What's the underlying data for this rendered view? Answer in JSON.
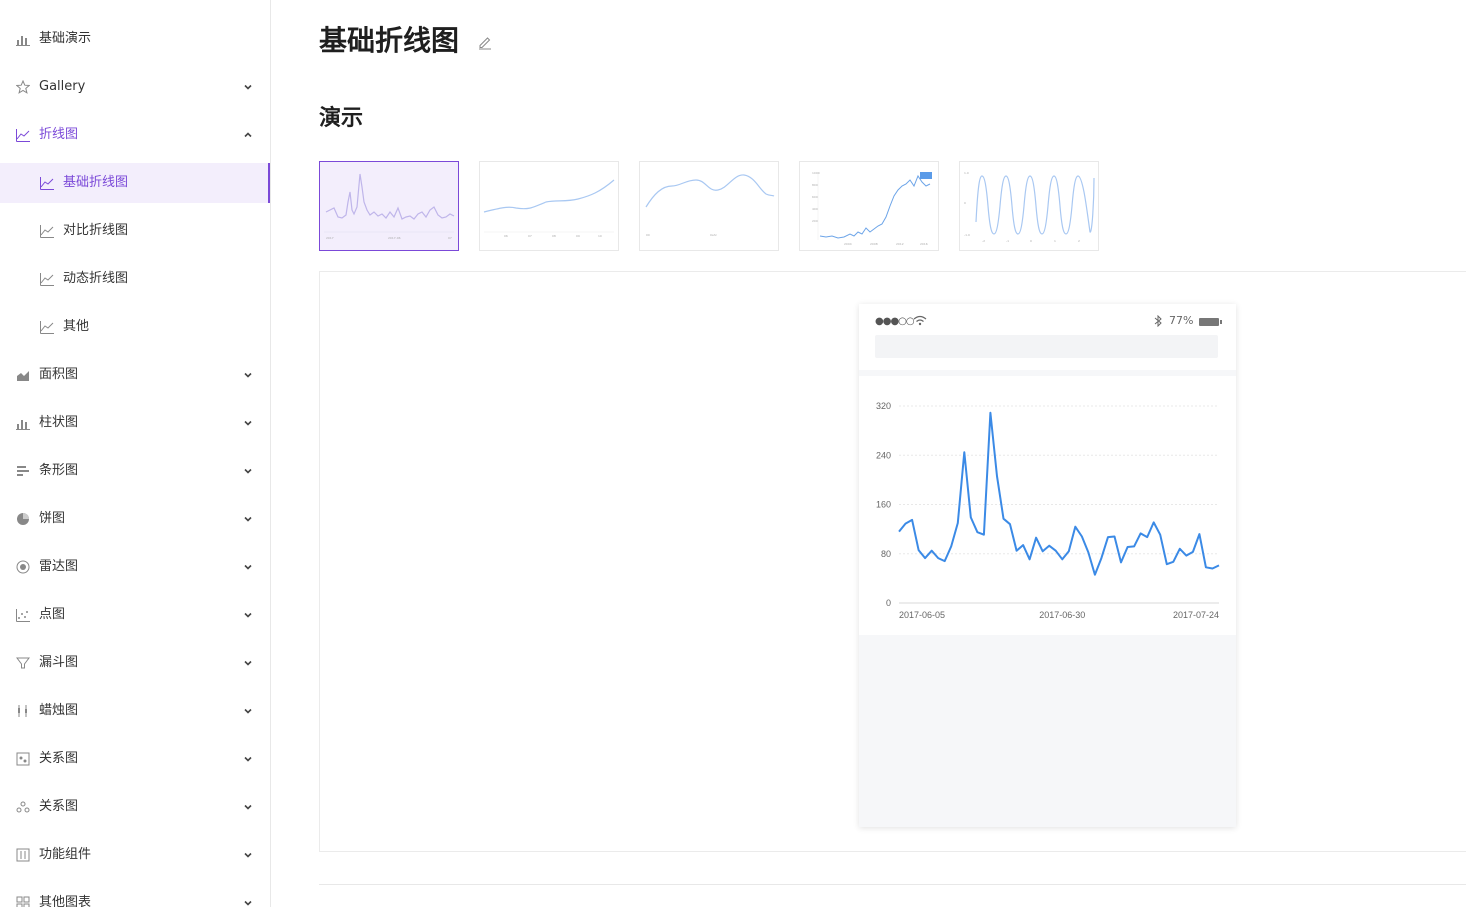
{
  "sidebar": {
    "items": [
      {
        "label": "基础演示",
        "icon": "bar-chart-icon",
        "chevron": "none",
        "state": "normal"
      },
      {
        "label": "Gallery",
        "icon": "star-icon",
        "chevron": "down",
        "state": "normal"
      },
      {
        "label": "折线图",
        "icon": "line-chart-icon",
        "chevron": "up",
        "state": "open"
      },
      {
        "label": "基础折线图",
        "icon": "line-chart-icon",
        "chevron": "none",
        "state": "active",
        "sub": true
      },
      {
        "label": "对比折线图",
        "icon": "line-chart-icon",
        "chevron": "none",
        "state": "normal",
        "sub": true
      },
      {
        "label": "动态折线图",
        "icon": "line-chart-icon",
        "chevron": "none",
        "state": "normal",
        "sub": true
      },
      {
        "label": "其他",
        "icon": "line-chart-icon",
        "chevron": "none",
        "state": "normal",
        "sub": true
      },
      {
        "label": "面积图",
        "icon": "area-chart-icon",
        "chevron": "down",
        "state": "normal"
      },
      {
        "label": "柱状图",
        "icon": "bar-chart-icon",
        "chevron": "down",
        "state": "normal"
      },
      {
        "label": "条形图",
        "icon": "bar-horizontal-icon",
        "chevron": "down",
        "state": "normal"
      },
      {
        "label": "饼图",
        "icon": "pie-chart-icon",
        "chevron": "down",
        "state": "normal"
      },
      {
        "label": "雷达图",
        "icon": "radar-chart-icon",
        "chevron": "down",
        "state": "normal"
      },
      {
        "label": "点图",
        "icon": "scatter-chart-icon",
        "chevron": "down",
        "state": "normal"
      },
      {
        "label": "漏斗图",
        "icon": "funnel-icon",
        "chevron": "down",
        "state": "normal"
      },
      {
        "label": "蜡烛图",
        "icon": "candlestick-icon",
        "chevron": "down",
        "state": "normal"
      },
      {
        "label": "关系图",
        "icon": "relation-chart-icon",
        "chevron": "down",
        "state": "normal"
      },
      {
        "label": "关系图",
        "icon": "graph-chart-icon",
        "chevron": "down",
        "state": "normal"
      },
      {
        "label": "功能组件",
        "icon": "component-icon",
        "chevron": "down",
        "state": "normal"
      },
      {
        "label": "其他图表",
        "icon": "grid-icon",
        "chevron": "down",
        "state": "normal"
      }
    ]
  },
  "page": {
    "title": "基础折线图",
    "section": "演示"
  },
  "colors": {
    "accent": "#7b49d8",
    "line": "#3b8ae6",
    "thumb_line": "#a9c8f2"
  },
  "thumbnails": [
    {
      "name": "thumb-basic-line",
      "selected": true
    },
    {
      "name": "thumb-smooth-rising",
      "selected": false
    },
    {
      "name": "thumb-smooth-wave",
      "selected": false
    },
    {
      "name": "thumb-trend-tooltip",
      "selected": false
    },
    {
      "name": "thumb-sine-wave",
      "selected": false
    }
  ],
  "phone": {
    "signal": "●●●○○",
    "battery": "77%"
  },
  "chart_data": {
    "type": "line",
    "x": [
      "2017-06-05",
      "2017-06-06",
      "2017-06-07",
      "2017-06-08",
      "2017-06-09",
      "2017-06-10",
      "2017-06-11",
      "2017-06-12",
      "2017-06-13",
      "2017-06-14",
      "2017-06-15",
      "2017-06-16",
      "2017-06-17",
      "2017-06-18",
      "2017-06-19",
      "2017-06-20",
      "2017-06-21",
      "2017-06-22",
      "2017-06-23",
      "2017-06-24",
      "2017-06-25",
      "2017-06-26",
      "2017-06-27",
      "2017-06-28",
      "2017-06-29",
      "2017-06-30",
      "2017-07-01",
      "2017-07-02",
      "2017-07-03",
      "2017-07-04",
      "2017-07-05",
      "2017-07-06",
      "2017-07-07",
      "2017-07-08",
      "2017-07-09",
      "2017-07-10",
      "2017-07-11",
      "2017-07-12",
      "2017-07-13",
      "2017-07-14",
      "2017-07-15",
      "2017-07-16",
      "2017-07-17",
      "2017-07-18",
      "2017-07-19",
      "2017-07-20",
      "2017-07-21",
      "2017-07-22",
      "2017-07-23",
      "2017-07-24"
    ],
    "values": [
      116,
      129,
      135,
      86,
      73,
      85,
      73,
      68,
      92,
      130,
      245,
      139,
      115,
      111,
      309,
      206,
      137,
      128,
      85,
      94,
      71,
      106,
      84,
      93,
      85,
      71,
      84,
      124,
      108,
      82,
      46,
      73,
      107,
      108,
      66,
      91,
      92,
      113,
      107,
      131,
      111,
      63,
      67,
      88,
      77,
      83,
      112,
      58,
      56,
      61
    ],
    "xticks": [
      "2017-06-05",
      "2017-06-30",
      "2017-07-24"
    ],
    "yticks": [
      "0",
      "80",
      "160",
      "240",
      "320"
    ],
    "ylim": [
      0,
      320
    ],
    "grid": true
  }
}
